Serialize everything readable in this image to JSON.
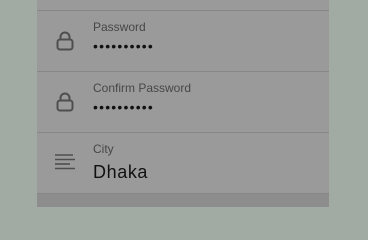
{
  "form": {
    "password": {
      "label": "Password",
      "value": "••••••••••",
      "icon": "lock-icon"
    },
    "confirm_password": {
      "label": "Confirm Password",
      "value": "••••••••••",
      "icon": "lock-icon"
    },
    "city": {
      "label": "City",
      "value": "Dhaka",
      "icon": "text-lines-icon"
    }
  },
  "colors": {
    "page_background": "#a2aba3",
    "panel_background": "#9a9a9a",
    "divider": "#878787",
    "label_text": "#474747",
    "value_text": "#111111",
    "icon": "#4e4e4e",
    "highlighted_row": "#8d8d8d"
  }
}
